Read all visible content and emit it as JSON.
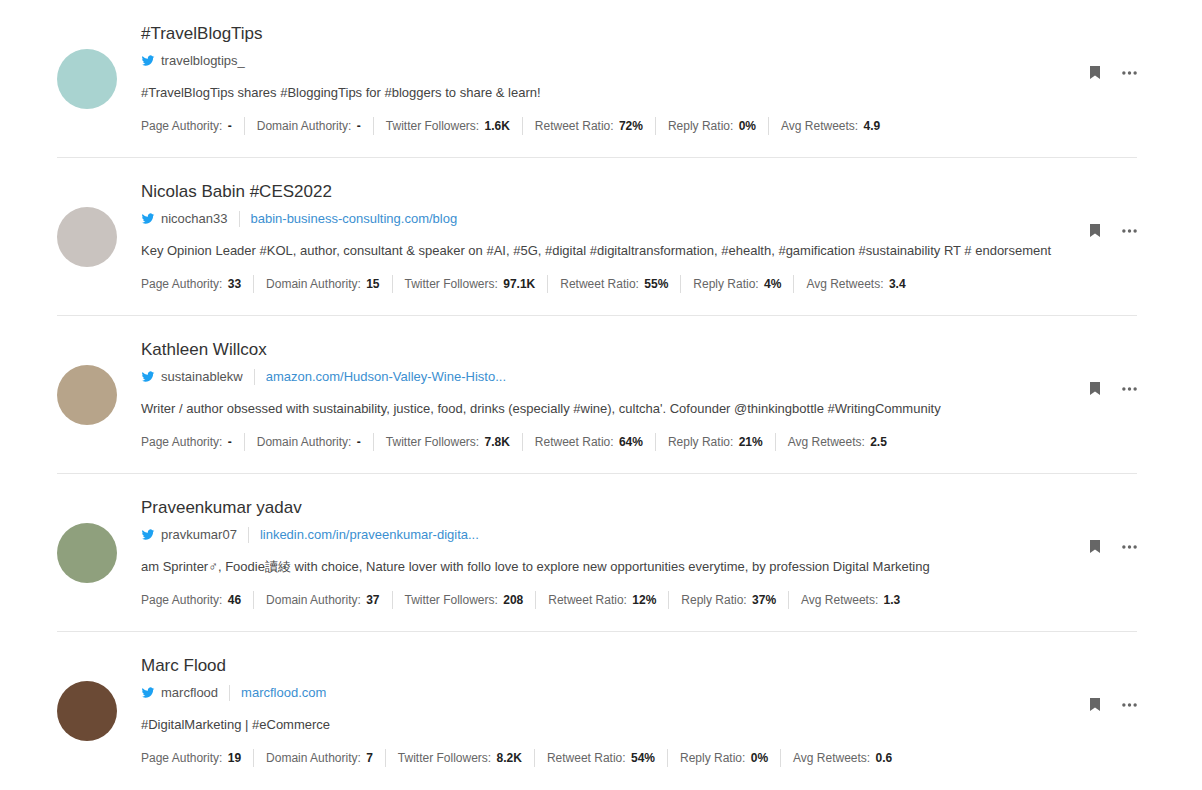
{
  "profiles": [
    {
      "name": "#TravelBlogTips",
      "handle": "travelblogtips_",
      "bio": "#TravelBlogTips shares #BloggingTips for #bloggers to share & learn!",
      "metrics": [
        {
          "label": "Page Authority:",
          "value": "-"
        },
        {
          "label": "Domain Authority:",
          "value": "-"
        },
        {
          "label": "Twitter Followers:",
          "value": "1.6K"
        },
        {
          "label": "Retweet Ratio:",
          "value": "72%"
        },
        {
          "label": "Reply Ratio:",
          "value": "0%"
        },
        {
          "label": "Avg Retweets:",
          "value": "4.9"
        }
      ]
    },
    {
      "name": "Nicolas Babin #CES2022",
      "handle": "nicochan33",
      "url": "babin-business-consulting.com/blog",
      "bio": "Key Opinion Leader #KOL, author, consultant & speaker on #AI, #5G, #digital #digitaltransformation, #ehealth, #gamification #sustainability RT # endorsement",
      "metrics": [
        {
          "label": "Page Authority:",
          "value": "33"
        },
        {
          "label": "Domain Authority:",
          "value": "15"
        },
        {
          "label": "Twitter Followers:",
          "value": "97.1K"
        },
        {
          "label": "Retweet Ratio:",
          "value": "55%"
        },
        {
          "label": "Reply Ratio:",
          "value": "4%"
        },
        {
          "label": "Avg Retweets:",
          "value": "3.4"
        }
      ]
    },
    {
      "name": "Kathleen Willcox",
      "handle": "sustainablekw",
      "url": "amazon.com/Hudson-Valley-Wine-Histo...",
      "bio": "Writer / author obsessed with sustainability, justice, food, drinks (especially #wine), cultcha'. Cofounder @thinkingbottle #WritingCommunity",
      "metrics": [
        {
          "label": "Page Authority:",
          "value": "-"
        },
        {
          "label": "Domain Authority:",
          "value": "-"
        },
        {
          "label": "Twitter Followers:",
          "value": "7.8K"
        },
        {
          "label": "Retweet Ratio:",
          "value": "64%"
        },
        {
          "label": "Reply Ratio:",
          "value": "21%"
        },
        {
          "label": "Avg Retweets:",
          "value": "2.5"
        }
      ]
    },
    {
      "name": "Praveenkumar yadav",
      "handle": "pravkumar07",
      "url": "linkedin.com/in/praveenkumar-digita...",
      "bio": "am Sprinter♂, Foodie讀綾 with choice, Nature lover with follo love to explore new opportunities everytime, by profession Digital Marketing",
      "metrics": [
        {
          "label": "Page Authority:",
          "value": "46"
        },
        {
          "label": "Domain Authority:",
          "value": "37"
        },
        {
          "label": "Twitter Followers:",
          "value": "208"
        },
        {
          "label": "Retweet Ratio:",
          "value": "12%"
        },
        {
          "label": "Reply Ratio:",
          "value": "37%"
        },
        {
          "label": "Avg Retweets:",
          "value": "1.3"
        }
      ]
    },
    {
      "name": "Marc Flood",
      "handle": "marcflood",
      "url": "marcflood.com",
      "bio": "#DigitalMarketing | #eCommerce",
      "metrics": [
        {
          "label": "Page Authority:",
          "value": "19"
        },
        {
          "label": "Domain Authority:",
          "value": "7"
        },
        {
          "label": "Twitter Followers:",
          "value": "8.2K"
        },
        {
          "label": "Retweet Ratio:",
          "value": "54%"
        },
        {
          "label": "Reply Ratio:",
          "value": "0%"
        },
        {
          "label": "Avg Retweets:",
          "value": "0.6"
        }
      ]
    }
  ]
}
